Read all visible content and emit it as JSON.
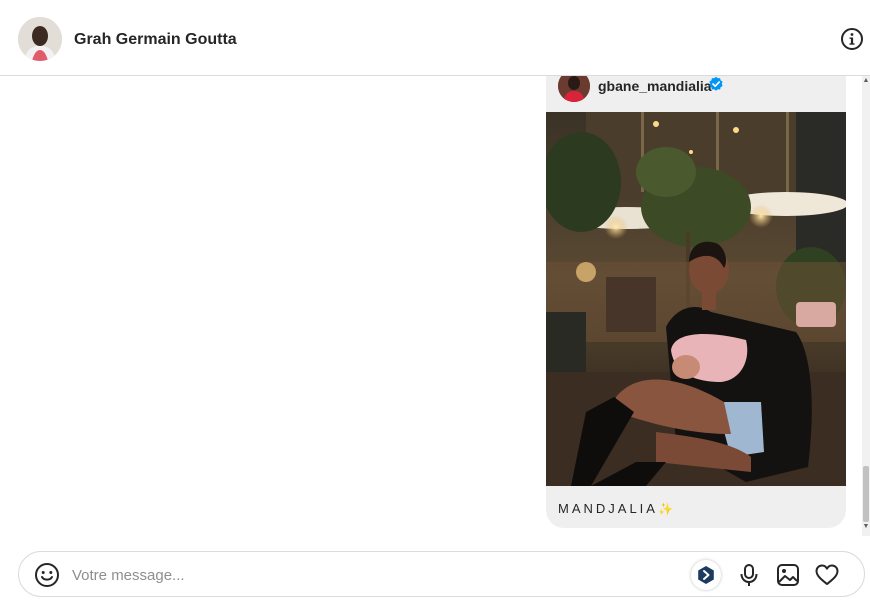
{
  "header": {
    "contact_name": "Grah Germain Goutta",
    "avatar_icon": "user-avatar",
    "info_icon": "info-icon"
  },
  "message_card": {
    "username": "gbane_mandialia",
    "verified": true,
    "caption": "MANDJALIA",
    "caption_emoji": "✨",
    "photo": "woman-seated-night-terrace",
    "accent_color": "#0095f6"
  },
  "composer": {
    "placeholder": "Votre message...",
    "value": "",
    "emoji_icon": "smiley-icon",
    "ai_icon": "ai-assistant-icon",
    "mic_icon": "microphone-icon",
    "image_icon": "image-icon",
    "heart_icon": "heart-icon"
  }
}
